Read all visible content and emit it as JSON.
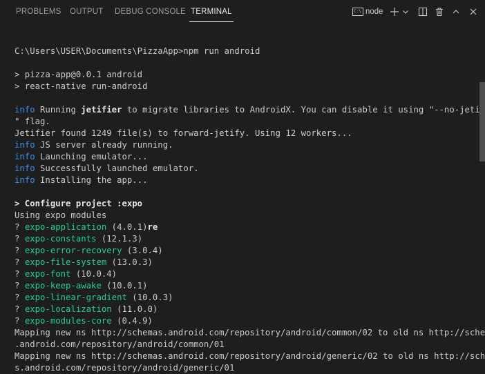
{
  "tabs": [
    {
      "label": "PROBLEMS",
      "active": false
    },
    {
      "label": "OUTPUT",
      "active": false
    },
    {
      "label": "DEBUG CONSOLE",
      "active": false
    },
    {
      "label": "TERMINAL",
      "active": true
    }
  ],
  "toolbar": {
    "shell_label": "node",
    "terminal_icon_text": "C:\\"
  },
  "terminal": {
    "lines": [
      "C:\\Users\\USER\\Documents\\PizzaApp>npm run android",
      "",
      "> pizza-app@0.0.1 android",
      "> react-native run-android",
      "",
      {
        "segments": [
          {
            "text": "info",
            "style": "info"
          },
          {
            "text": " Running "
          },
          {
            "text": "jetifier",
            "style": "bold"
          },
          {
            "text": " to migrate libraries to AndroidX. You can disable it using \"--no-jetifie"
          }
        ]
      },
      "\" flag.",
      "Jetifier found 1249 file(s) to forward-jetify. Using 12 workers...",
      {
        "segments": [
          {
            "text": "info",
            "style": "info"
          },
          {
            "text": " JS server already running."
          }
        ]
      },
      {
        "segments": [
          {
            "text": "info",
            "style": "info"
          },
          {
            "text": " Launching emulator..."
          }
        ]
      },
      {
        "segments": [
          {
            "text": "info",
            "style": "info"
          },
          {
            "text": " Successfully launched emulator."
          }
        ]
      },
      {
        "segments": [
          {
            "text": "info",
            "style": "info"
          },
          {
            "text": " Installing the app..."
          }
        ]
      },
      "",
      {
        "segments": [
          {
            "text": "> Configure project :expo",
            "style": "bold"
          }
        ]
      },
      "Using expo modules",
      {
        "segments": [
          {
            "text": "? "
          },
          {
            "text": "expo-application",
            "style": "green"
          },
          {
            "text": " (4.0.1)"
          },
          {
            "text": "re",
            "style": "bold"
          }
        ]
      },
      {
        "segments": [
          {
            "text": "? "
          },
          {
            "text": "expo-constants",
            "style": "green"
          },
          {
            "text": " (12.1.3)"
          }
        ]
      },
      {
        "segments": [
          {
            "text": "? "
          },
          {
            "text": "expo-error-recovery",
            "style": "green"
          },
          {
            "text": " (3.0.4)"
          }
        ]
      },
      {
        "segments": [
          {
            "text": "? "
          },
          {
            "text": "expo-file-system",
            "style": "green"
          },
          {
            "text": " (13.0.3)"
          }
        ]
      },
      {
        "segments": [
          {
            "text": "? "
          },
          {
            "text": "expo-font",
            "style": "green"
          },
          {
            "text": " (10.0.4)"
          }
        ]
      },
      {
        "segments": [
          {
            "text": "? "
          },
          {
            "text": "expo-keep-awake",
            "style": "green"
          },
          {
            "text": " (10.0.1)"
          }
        ]
      },
      {
        "segments": [
          {
            "text": "? "
          },
          {
            "text": "expo-linear-gradient",
            "style": "green"
          },
          {
            "text": " (10.0.3)"
          }
        ]
      },
      {
        "segments": [
          {
            "text": "? "
          },
          {
            "text": "expo-localization",
            "style": "green"
          },
          {
            "text": " (11.0.0)"
          }
        ]
      },
      {
        "segments": [
          {
            "text": "? "
          },
          {
            "text": "expo-modules-core",
            "style": "green"
          },
          {
            "text": " (0.4.9)"
          }
        ]
      },
      "Mapping new ns http://schemas.android.com/repository/android/common/02 to old ns http://schema",
      ".android.com/repository/android/common/01",
      "Mapping new ns http://schemas.android.com/repository/android/generic/02 to old ns http://schem",
      "s.android.com/repository/android/generic/01"
    ]
  }
}
